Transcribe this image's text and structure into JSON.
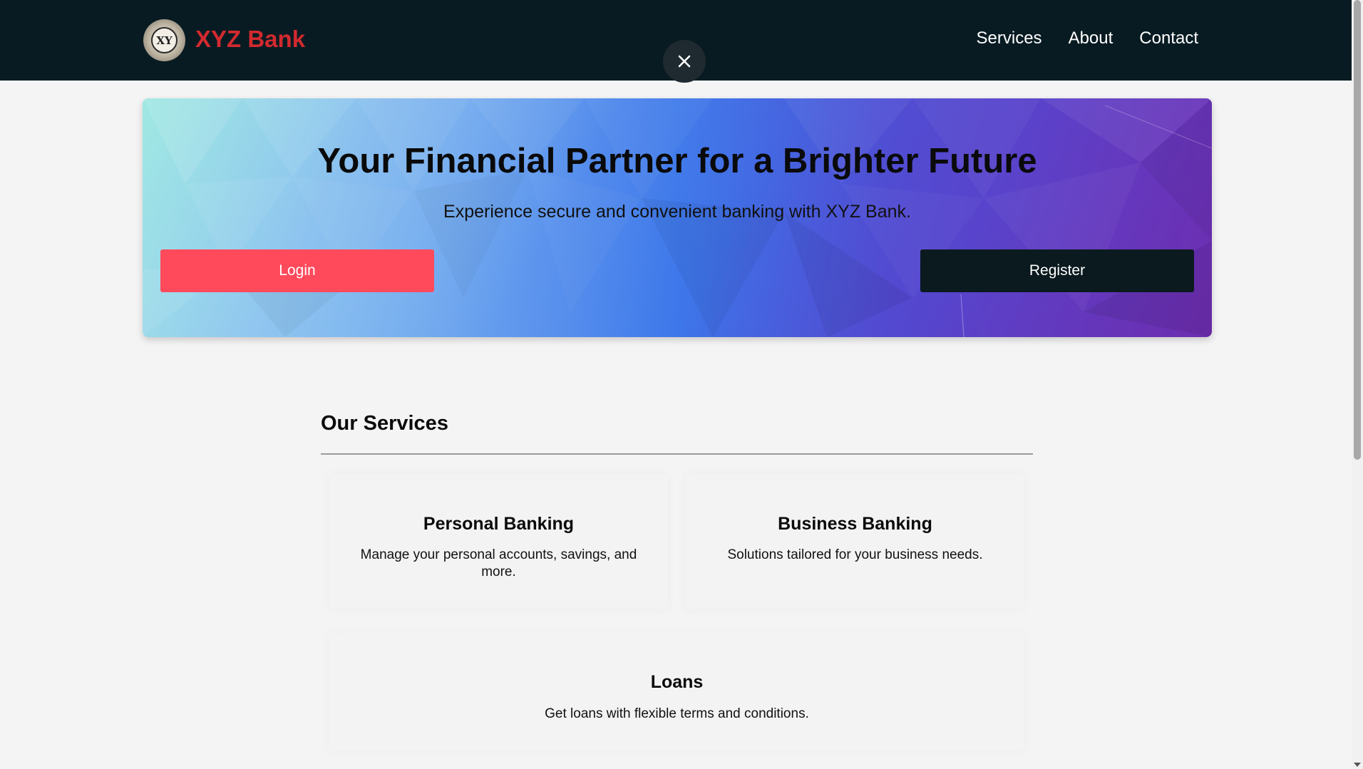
{
  "header": {
    "brand": "XYZ Bank",
    "logo_text": "XY",
    "nav": [
      "Services",
      "About",
      "Contact"
    ],
    "close_icon": "close-icon"
  },
  "hero": {
    "title": "Your Financial Partner for a Brighter Future",
    "subtitle": "Experience secure and convenient banking with XYZ Bank.",
    "login_label": "Login",
    "register_label": "Register"
  },
  "services": {
    "heading": "Our Services",
    "cards": [
      {
        "title": "Personal Banking",
        "description": "Manage your personal accounts, savings, and more."
      },
      {
        "title": "Business Banking",
        "description": "Solutions tailored for your business needs."
      },
      {
        "title": "Loans",
        "description": "Get loans with flexible terms and conditions."
      }
    ]
  },
  "colors": {
    "header_bg": "#081b22",
    "brand": "#d22a2f",
    "login_bg": "#ff4a5c",
    "register_bg": "#0b1a1f"
  }
}
